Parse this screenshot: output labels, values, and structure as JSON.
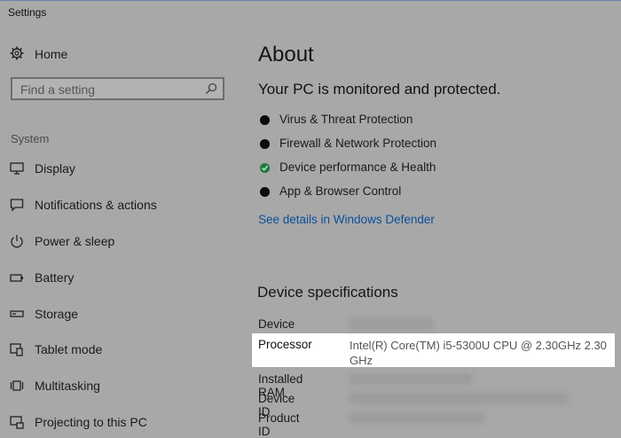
{
  "window": {
    "title": "Settings"
  },
  "sidebar": {
    "home_label": "Home",
    "search_placeholder": "Find a setting",
    "section_label": "System",
    "items": [
      {
        "label": "Display",
        "icon": "monitor-icon"
      },
      {
        "label": "Notifications & actions",
        "icon": "notification-icon"
      },
      {
        "label": "Power & sleep",
        "icon": "power-icon"
      },
      {
        "label": "Battery",
        "icon": "battery-icon"
      },
      {
        "label": "Storage",
        "icon": "storage-icon"
      },
      {
        "label": "Tablet mode",
        "icon": "tablet-mode-icon"
      },
      {
        "label": "Multitasking",
        "icon": "multitasking-icon"
      },
      {
        "label": "Projecting to this PC",
        "icon": "projecting-icon"
      }
    ]
  },
  "main": {
    "title": "About",
    "status": "Your PC is monitored and protected.",
    "protection": [
      {
        "label": "Virus & Threat Protection",
        "state": "black"
      },
      {
        "label": "Firewall & Network Protection",
        "state": "black"
      },
      {
        "label": "Device performance & Health",
        "state": "green-check"
      },
      {
        "label": "App & Browser Control",
        "state": "black"
      }
    ],
    "defender_link": "See details in Windows Defender",
    "specs_title": "Device specifications",
    "specs": {
      "device_name_label": "Device name",
      "processor_label": "Processor",
      "processor_value": "Intel(R) Core(TM) i5-5300U CPU @ 2.30GHz   2.30 GHz",
      "ram_label": "Installed RAM",
      "device_id_label": "Device ID",
      "product_id_label": "Product ID"
    }
  },
  "colors": {
    "overlay_gray": "#a8a8a8",
    "highlight": "#ffffff",
    "link": "#0b4f9a",
    "ok_green": "#1e7a3e"
  }
}
